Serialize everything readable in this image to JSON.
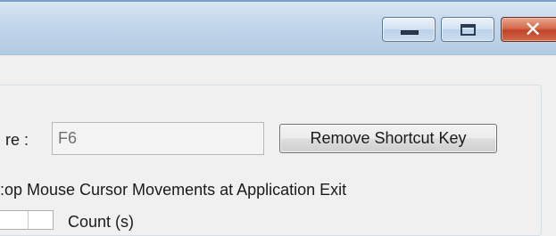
{
  "window": {
    "controls": {
      "minimize_icon": "minimize-icon",
      "maximize_icon": "maximize-icon",
      "close_icon": "close-icon",
      "close_glyph": "✕"
    }
  },
  "hotkey": {
    "label": "re :",
    "value": "F6",
    "remove_button_label": "Remove Shortcut Key"
  },
  "options": {
    "stop_text": ":op Mouse Cursor Movements at Application Exit",
    "count_label": "Count (s)"
  }
}
